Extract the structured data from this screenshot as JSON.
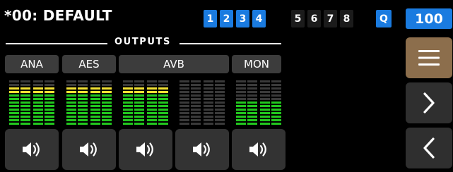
{
  "header": {
    "preset_title": "*00: DEFAULT",
    "banks": [
      {
        "label": "1",
        "active": true
      },
      {
        "label": "2",
        "active": true
      },
      {
        "label": "3",
        "active": true
      },
      {
        "label": "4",
        "active": true
      },
      {
        "label": "5",
        "active": false
      },
      {
        "label": "6",
        "active": false
      },
      {
        "label": "7",
        "active": false
      },
      {
        "label": "8",
        "active": false
      }
    ],
    "q_label": "Q",
    "level_value": "100"
  },
  "outputs": {
    "section_label": "OUTPUTS",
    "groups": [
      {
        "label": "ANA"
      },
      {
        "label": "AES"
      },
      {
        "label": "AVB"
      },
      {
        "label": "MON"
      }
    ],
    "meters": [
      {
        "id": "ana",
        "level_segments": 9,
        "peak_segments": 2
      },
      {
        "id": "aes",
        "level_segments": 9,
        "peak_segments": 2
      },
      {
        "id": "avb-1",
        "level_segments": 9,
        "peak_segments": 2
      },
      {
        "id": "avb-2",
        "level_segments": 0,
        "peak_segments": 0
      },
      {
        "id": "mon",
        "level_segments": 7,
        "peak_segments": 0
      }
    ],
    "mute_icon": "speaker-icon"
  },
  "side_icons": {
    "menu": "hamburger-menu-icon",
    "next": "chevron-right-icon",
    "prev": "chevron-left-icon"
  },
  "colors": {
    "accent_blue": "#1a7be0",
    "menu_tan": "#8c6e4c",
    "meter_green": "#22c81e",
    "meter_yellow": "#f2e233",
    "meter_off": "#3a3a3a"
  }
}
